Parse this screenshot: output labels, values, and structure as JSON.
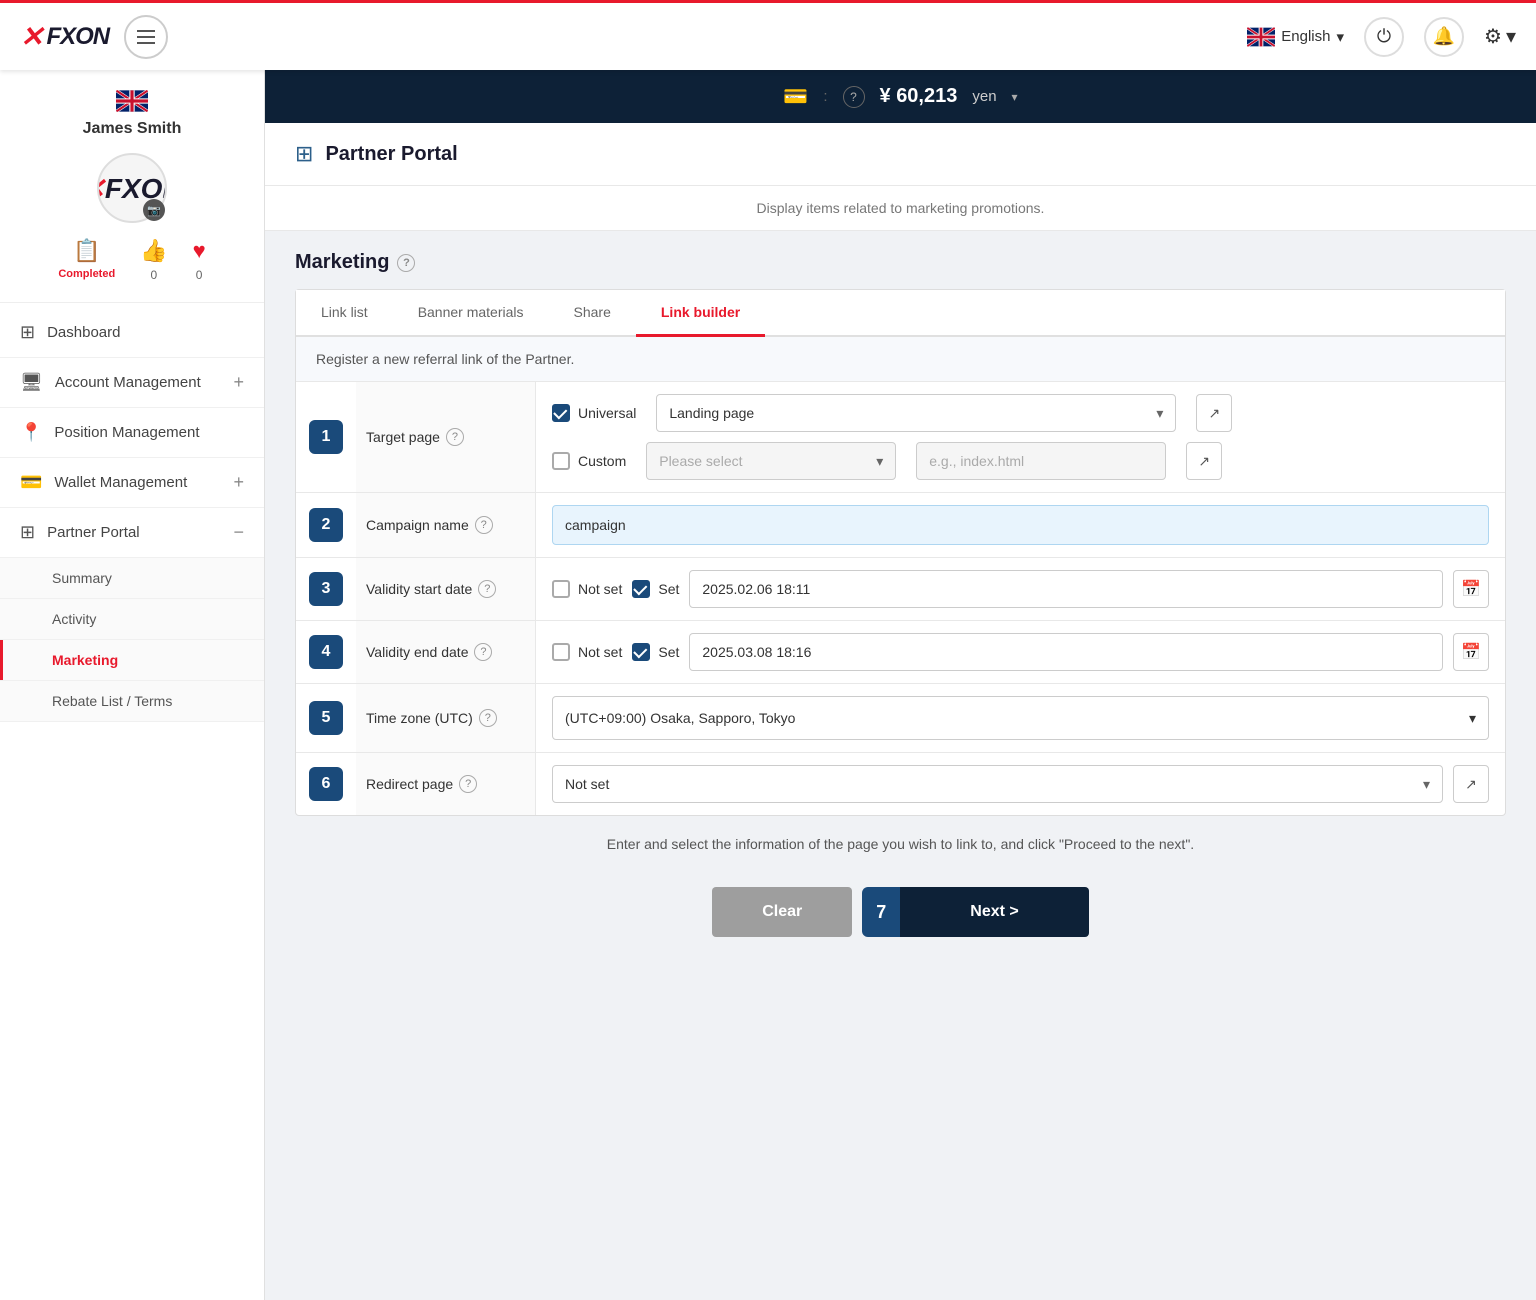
{
  "app": {
    "name": "FXON",
    "logo_x": "X",
    "logo_text": "FXON"
  },
  "topnav": {
    "language": "English",
    "balance": "60,213",
    "currency": "yen"
  },
  "sidebar": {
    "user_name": "James Smith",
    "stats": {
      "completed_label": "Completed",
      "like_count": "0",
      "heart_count": "0"
    },
    "nav_items": [
      {
        "id": "dashboard",
        "label": "Dashboard",
        "icon": "⊞"
      },
      {
        "id": "account_management",
        "label": "Account Management",
        "icon": "🖥",
        "has_plus": true
      },
      {
        "id": "position_management",
        "label": "Position Management",
        "icon": "📍"
      },
      {
        "id": "wallet_management",
        "label": "Wallet Management",
        "icon": "💳",
        "has_plus": true
      },
      {
        "id": "partner_portal",
        "label": "Partner Portal",
        "icon": "⊞",
        "has_minus": true
      }
    ],
    "sub_nav": [
      {
        "id": "summary",
        "label": "Summary"
      },
      {
        "id": "activity",
        "label": "Activity"
      },
      {
        "id": "marketing",
        "label": "Marketing",
        "active": true
      },
      {
        "id": "rebate_list",
        "label": "Rebate List / Terms"
      }
    ]
  },
  "balance_bar": {
    "wallet_icon": "💳",
    "help_icon": "?",
    "amount": "¥ 60,213",
    "currency": "yen",
    "dropdown": "▾"
  },
  "page": {
    "title": "Partner Portal",
    "subtitle": "Display items related to marketing promotions."
  },
  "marketing": {
    "title": "Marketing",
    "tabs": [
      {
        "id": "link_list",
        "label": "Link list"
      },
      {
        "id": "banner_materials",
        "label": "Banner materials"
      },
      {
        "id": "share",
        "label": "Share"
      },
      {
        "id": "link_builder",
        "label": "Link builder",
        "active": true
      }
    ],
    "info_bar": "Register a new referral link of the Partner.",
    "form": {
      "rows": [
        {
          "step": "1",
          "label": "Target page",
          "has_help": true,
          "type": "target_page"
        },
        {
          "step": "2",
          "label": "Campaign name",
          "has_help": true,
          "type": "text",
          "value": "campaign",
          "placeholder": "campaign"
        },
        {
          "step": "3",
          "label": "Validity start date",
          "has_help": true,
          "type": "date",
          "not_set": "Not set",
          "set_label": "Set",
          "value": "2025.02.06 18:11"
        },
        {
          "step": "4",
          "label": "Validity end date",
          "has_help": true,
          "type": "date",
          "not_set": "Not set",
          "set_label": "Set",
          "value": "2025.03.08 18:16"
        },
        {
          "step": "5",
          "label": "Time zone (UTC)",
          "has_help": true,
          "type": "timezone",
          "value": "(UTC+09:00) Osaka, Sapporo, Tokyo"
        },
        {
          "step": "6",
          "label": "Redirect page",
          "has_help": true,
          "type": "redirect",
          "value": "Not set"
        }
      ]
    },
    "target_page": {
      "universal_label": "Universal",
      "universal_value": "Landing page",
      "custom_label": "Custom",
      "custom_placeholder": "Please select",
      "custom_text_placeholder": "e.g., index.html"
    },
    "instructions": "Enter and select the information of the page you wish to link to, and click \"Proceed to the next\".",
    "buttons": {
      "clear": "Clear",
      "next": "Next >",
      "next_step": "7"
    }
  }
}
